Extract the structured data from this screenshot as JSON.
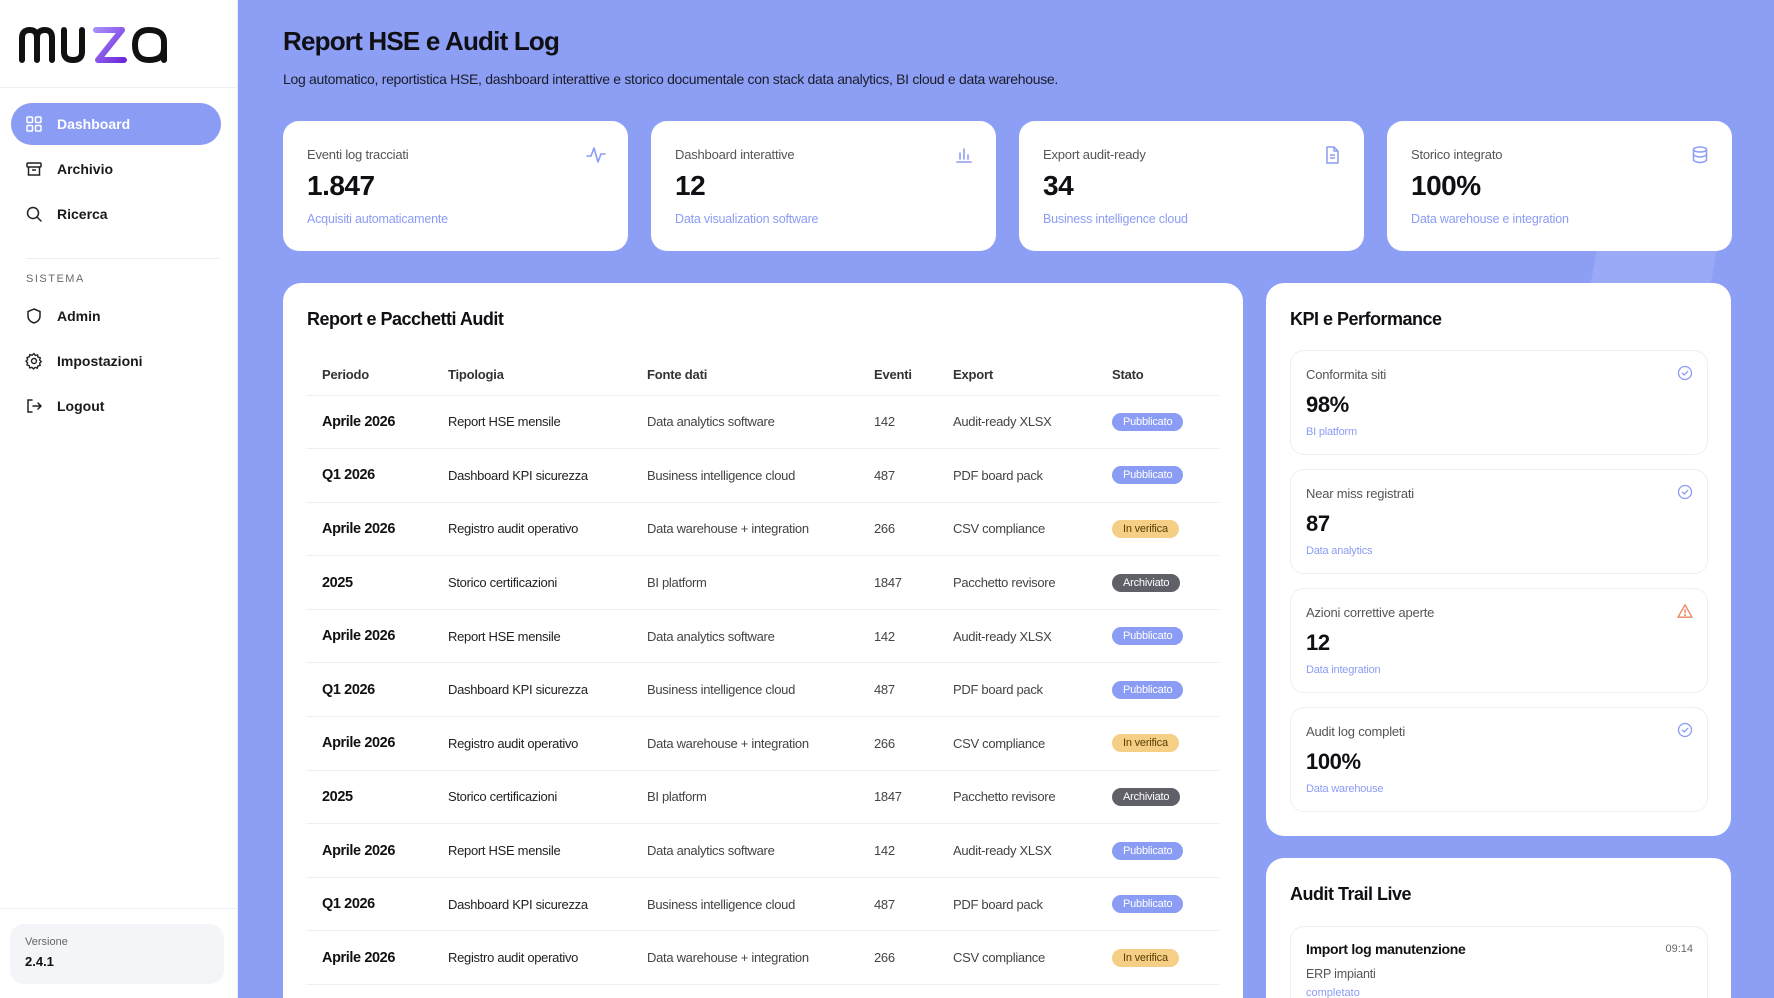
{
  "app": {
    "name": "muza"
  },
  "sidebar": {
    "nav": [
      {
        "label": "Dashboard",
        "icon": "grid-icon",
        "active": true
      },
      {
        "label": "Archivio",
        "icon": "archive-icon"
      },
      {
        "label": "Ricerca",
        "icon": "search-icon"
      }
    ],
    "section_label": "SISTEMA",
    "system_nav": [
      {
        "label": "Admin",
        "icon": "shield-icon"
      },
      {
        "label": "Impostazioni",
        "icon": "gear-icon"
      },
      {
        "label": "Logout",
        "icon": "logout-icon"
      }
    ],
    "version_label": "Versione",
    "version_value": "2.4.1"
  },
  "header": {
    "title": "Report HSE e Audit Log",
    "subtitle": "Log automatico, reportistica HSE, dashboard interattive e storico documentale con stack data analytics, BI cloud e data warehouse."
  },
  "stats": [
    {
      "label": "Eventi log tracciati",
      "value": "1.847",
      "sub": "Acquisiti automaticamente",
      "icon": "activity-icon"
    },
    {
      "label": "Dashboard interattive",
      "value": "12",
      "sub": "Data visualization software",
      "icon": "bar-chart-icon"
    },
    {
      "label": "Export audit-ready",
      "value": "34",
      "sub": "Business intelligence cloud",
      "icon": "document-icon"
    },
    {
      "label": "Storico integrato",
      "value": "100%",
      "sub": "Data warehouse e integration",
      "icon": "database-icon"
    }
  ],
  "reports": {
    "title": "Report e Pacchetti Audit",
    "columns": [
      "Periodo",
      "Tipologia",
      "Fonte dati",
      "Eventi",
      "Export",
      "Stato"
    ],
    "rows": [
      {
        "period": "Aprile 2026",
        "type": "Report HSE mensile",
        "source": "Data analytics software",
        "events": "142",
        "export": "Audit-ready XLSX",
        "status": "Pubblicato",
        "status_kind": "pub"
      },
      {
        "period": "Q1 2026",
        "type": "Dashboard KPI sicurezza",
        "source": "Business intelligence cloud",
        "events": "487",
        "export": "PDF board pack",
        "status": "Pubblicato",
        "status_kind": "pub"
      },
      {
        "period": "Aprile 2026",
        "type": "Registro audit operativo",
        "source": "Data warehouse + integration",
        "events": "266",
        "export": "CSV compliance",
        "status": "In verifica",
        "status_kind": "ver"
      },
      {
        "period": "2025",
        "type": "Storico certificazioni",
        "source": "BI platform",
        "events": "1847",
        "export": "Pacchetto revisore",
        "status": "Archiviato",
        "status_kind": "arc"
      },
      {
        "period": "Aprile 2026",
        "type": "Report HSE mensile",
        "source": "Data analytics software",
        "events": "142",
        "export": "Audit-ready XLSX",
        "status": "Pubblicato",
        "status_kind": "pub"
      },
      {
        "period": "Q1 2026",
        "type": "Dashboard KPI sicurezza",
        "source": "Business intelligence cloud",
        "events": "487",
        "export": "PDF board pack",
        "status": "Pubblicato",
        "status_kind": "pub"
      },
      {
        "period": "Aprile 2026",
        "type": "Registro audit operativo",
        "source": "Data warehouse + integration",
        "events": "266",
        "export": "CSV compliance",
        "status": "In verifica",
        "status_kind": "ver"
      },
      {
        "period": "2025",
        "type": "Storico certificazioni",
        "source": "BI platform",
        "events": "1847",
        "export": "Pacchetto revisore",
        "status": "Archiviato",
        "status_kind": "arc"
      },
      {
        "period": "Aprile 2026",
        "type": "Report HSE mensile",
        "source": "Data analytics software",
        "events": "142",
        "export": "Audit-ready XLSX",
        "status": "Pubblicato",
        "status_kind": "pub"
      },
      {
        "period": "Q1 2026",
        "type": "Dashboard KPI sicurezza",
        "source": "Business intelligence cloud",
        "events": "487",
        "export": "PDF board pack",
        "status": "Pubblicato",
        "status_kind": "pub"
      },
      {
        "period": "Aprile 2026",
        "type": "Registro audit operativo",
        "source": "Data warehouse + integration",
        "events": "266",
        "export": "CSV compliance",
        "status": "In verifica",
        "status_kind": "ver"
      }
    ]
  },
  "kpi": {
    "title": "KPI e Performance",
    "items": [
      {
        "label": "Conformita siti",
        "value": "98%",
        "sub": "BI platform",
        "icon": "check-circle-icon"
      },
      {
        "label": "Near miss registrati",
        "value": "87",
        "sub": "Data analytics",
        "icon": "check-circle-icon"
      },
      {
        "label": "Azioni correttive aperte",
        "value": "12",
        "sub": "Data integration",
        "icon": "warning-icon"
      },
      {
        "label": "Audit log completi",
        "value": "100%",
        "sub": "Data warehouse",
        "icon": "check-circle-icon"
      }
    ]
  },
  "trail": {
    "title": "Audit Trail Live",
    "items": [
      {
        "title": "Import log manutenzione",
        "time": "09:14",
        "source": "ERP impianti",
        "status": "completato"
      }
    ]
  },
  "colors": {
    "accent": "#8b9cf4",
    "background": "#8c9ff5",
    "warning": "#f5cf86",
    "archived": "#5f6068",
    "alert": "#e8845a"
  }
}
